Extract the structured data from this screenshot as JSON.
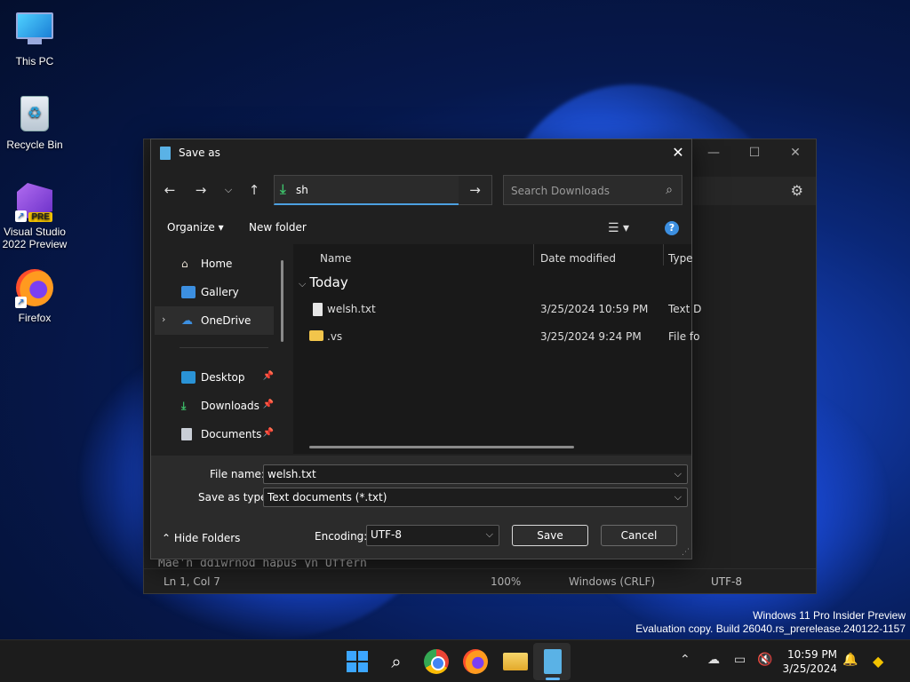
{
  "desktop": {
    "icons": [
      {
        "label": "This PC"
      },
      {
        "label": "Recycle Bin"
      },
      {
        "label": "Visual Studio 2022 Preview",
        "line1": "Visual Studio",
        "line2": "2022 Preview",
        "badge": "PRE"
      },
      {
        "label": "Firefox"
      }
    ],
    "watermark": {
      "line1": "Windows 11 Pro Insider Preview",
      "line2": "Evaluation copy. Build 26040.rs_prerelease.240122-1157"
    }
  },
  "notepad": {
    "visible_text": "Mae'n ddiwrnod hapus yn Uffern",
    "status": {
      "position": "Ln 1, Col 7",
      "zoom": "100%",
      "line_endings": "Windows (CRLF)",
      "encoding": "UTF-8"
    }
  },
  "dialog": {
    "title": "Save as",
    "address": {
      "value": "sh",
      "icon": "download-icon"
    },
    "search": {
      "placeholder": "Search Downloads"
    },
    "commands": {
      "organize": "Organize",
      "new_folder": "New folder"
    },
    "nav": [
      {
        "label": "Home",
        "icon": "home-icon",
        "color": "#e8e0d4"
      },
      {
        "label": "Gallery",
        "icon": "gallery-icon",
        "color": "#3c8fe0"
      },
      {
        "label": "OneDrive",
        "icon": "cloud-icon",
        "color": "#3c8fe0",
        "selected": true
      },
      {
        "label": "Desktop",
        "icon": "desktop-icon",
        "color": "#2a93d6",
        "pinned": true
      },
      {
        "label": "Downloads",
        "icon": "download-icon",
        "color": "#3dbf6a",
        "pinned": true
      },
      {
        "label": "Documents",
        "icon": "documents-icon",
        "color": "#c9ced6",
        "pinned": true
      }
    ],
    "columns": {
      "name": "Name",
      "date": "Date modified",
      "type": "Type"
    },
    "group": "Today",
    "files": [
      {
        "name": "welsh.txt",
        "date": "3/25/2024 10:59 PM",
        "type": "Text D",
        "kind": "text"
      },
      {
        "name": ".vs",
        "date": "3/25/2024 9:24 PM",
        "type": "File fo",
        "kind": "folder"
      }
    ],
    "file_name_label": "File name:",
    "file_name": "welsh.txt",
    "save_type_label": "Save as type:",
    "save_type": "Text documents (*.txt)",
    "hide_folders": "Hide Folders",
    "encoding_label": "Encoding:",
    "encoding": "UTF-8",
    "save": "Save",
    "cancel": "Cancel"
  },
  "taskbar": {
    "clock_time": "10:59 PM",
    "clock_date": "3/25/2024",
    "accent": "#60b6ff"
  }
}
